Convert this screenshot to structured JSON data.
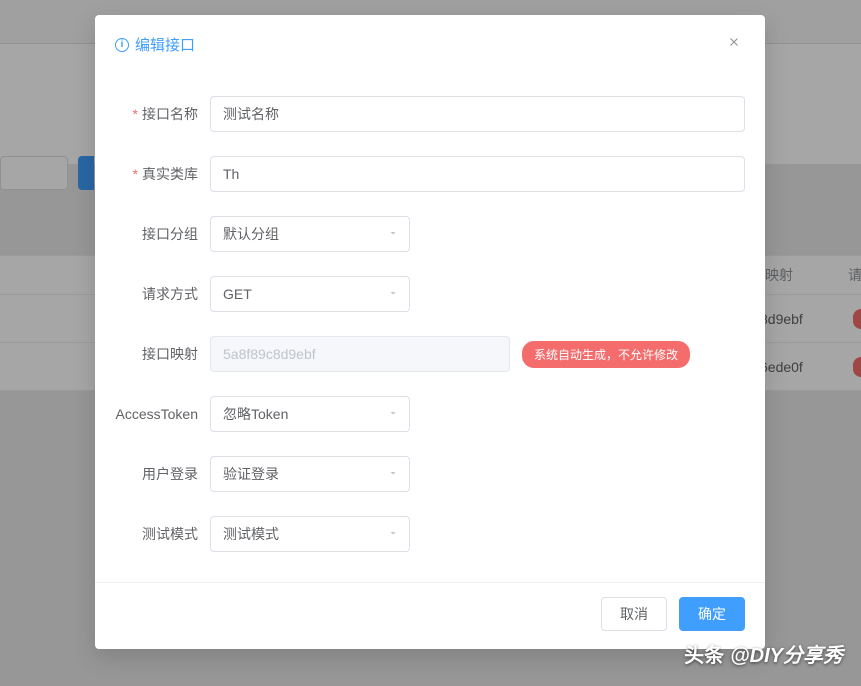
{
  "modal": {
    "title": "编辑接口",
    "fields": {
      "name": {
        "label": "接口名称",
        "value": "测试名称"
      },
      "realClass": {
        "label": "真实类库",
        "value": "Th"
      },
      "group": {
        "label": "接口分组",
        "value": "默认分组"
      },
      "method": {
        "label": "请求方式",
        "value": "GET"
      },
      "mapping": {
        "label": "接口映射",
        "placeholder": "5a8f89c8d9ebf",
        "badge": "系统自动生成，不允许修改"
      },
      "accessToken": {
        "label": "AccessToken",
        "value": "忽略Token"
      },
      "userLogin": {
        "label": "用户登录",
        "value": "验证登录"
      },
      "testMode": {
        "label": "测试模式",
        "value": "测试模式"
      }
    },
    "footer": {
      "cancel": "取消",
      "confirm": "确定"
    }
  },
  "bgTable": {
    "headerMap": "映射",
    "headerReq": "请",
    "row1": "8d9ebf",
    "row2": "6ede0f"
  },
  "watermark": {
    "logo": "头条",
    "text": "@DIY分享秀"
  }
}
